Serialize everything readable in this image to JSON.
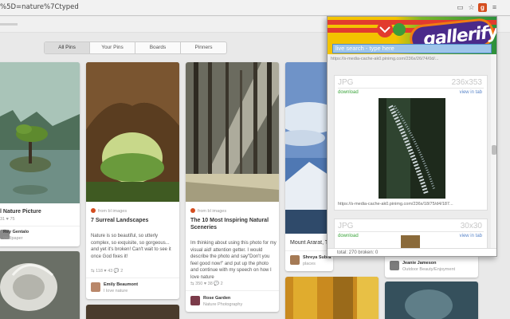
{
  "browser": {
    "url": "%5D=nature%7Ctyped",
    "icons": [
      "page-icon",
      "star-icon",
      "gallerify-extension-icon",
      "menu-icon"
    ]
  },
  "tabs": [
    {
      "label": "All Pins",
      "active": true
    },
    {
      "label": "Your Pins",
      "active": false
    },
    {
      "label": "Boards",
      "active": false
    },
    {
      "label": "Pinners",
      "active": false
    }
  ],
  "pins": {
    "p1": {
      "title": "l Nature Picture",
      "stats": "31  ♥ 75",
      "user": "Rey Gentalo",
      "board": "Wallpaper"
    },
    "p2": {
      "source": "from bl images",
      "title": "7 Surreal Landscapes",
      "desc": "Nature is so beautiful, so utterly complex, so exquisite, so gorgeous... and yet it's broken! Can't wait to see it once God fixes it!",
      "stats": "⇆ 118  ♥ 43  💬 2",
      "user": "Emily Beaumont",
      "board": "I love nature"
    },
    "p3": {
      "source": "from bl images",
      "title": "The 10 Most Inspiring Natural Sceneries",
      "desc": "Im thinking about using this photo for my visual aid! attention getter. I would describe the photo and say\"Don't you feel good now!\" and put up the photo and continue with my speech on how I love nature",
      "stats": "⇆ 350  ♥ 38  💬 2",
      "user": "Rose Garden",
      "board": "Nature Photography"
    },
    "p4": {
      "title": "Mount Ararat, Tu",
      "user": "Shreya Subra",
      "board": "places"
    },
    "p5": {
      "user": "Jeanie Jameson",
      "board": "Outdoor Beauty/Enjoyment"
    }
  },
  "gallerify": {
    "brand": "gallerify",
    "search_placeholder": "live search - type here",
    "partial_url": "https://s-media-cache-ak0.pinimg.com/236x/26/74/0d/...",
    "card1": {
      "type": "JPG",
      "dims": "236x353",
      "download": "download",
      "view": "view in tab",
      "url": "https://s-media-cache-ak0.pinimg.com/236x/18/75/d4/187..."
    },
    "card2": {
      "type": "JPG",
      "dims": "30x30",
      "download": "download",
      "view": "view in tab"
    },
    "footer": "total: 270    broken: 0"
  }
}
